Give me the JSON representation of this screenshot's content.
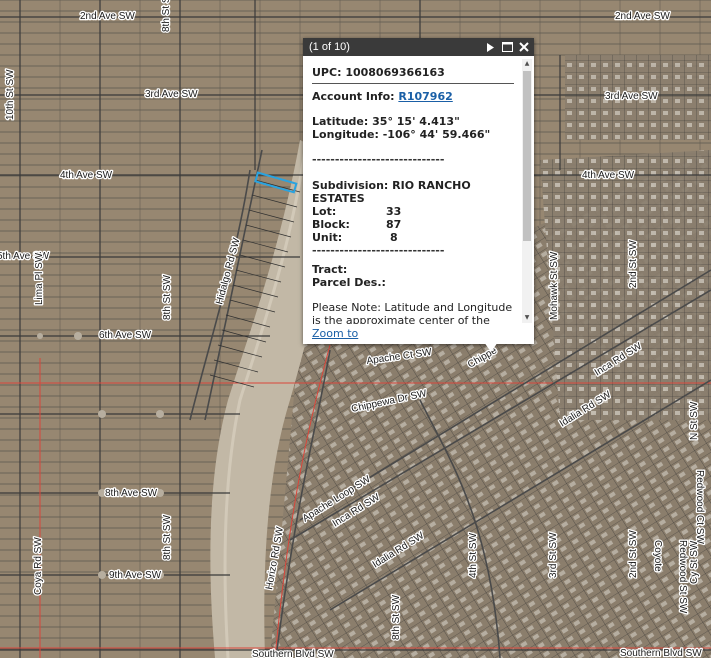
{
  "map": {
    "streets": {
      "2nd_ave_sw_w": "2nd Ave SW",
      "2nd_ave_sw_e": "2nd Ave SW",
      "3rd_ave_sw_w": "3rd Ave SW",
      "3rd_ave_sw_e": "3rd Ave SW",
      "4th_ave_sw_w": "4th Ave SW",
      "4th_ave_sw_e": "4th Ave SW",
      "5th_ave_sw": "5th Ave SW",
      "6th_ave_sw": "6th Ave SW",
      "8th_ave_sw": "8th Ave SW",
      "9th_ave_sw": "9th Ave SW",
      "10th_st_sw": "10th St SW",
      "8th_st_sw_n": "8th St SW",
      "8th_st_sw_mid": "8th St SW",
      "8th_st_sw_s": "8th St SW",
      "8th_st_sw_se": "8th St SW",
      "lima_pl_sw": "Lima Pl SW",
      "coya_rd_sw": "Coya Rd SW",
      "hidalgo_rd_sw": "Hidalgo Rd SW",
      "horizon_rd_sw": "Horizo Rd SW",
      "apache_ct_sw": "Apache Ct SW",
      "chippewa_dr_sw": "Chippewa Dr SW",
      "chippewa_short": "Chippe",
      "apache_loop_sw": "Apache Loop SW",
      "inca_rd_sw_e": "Inca Rd SW",
      "inca_rd_sw_w": "Inca Rd SW",
      "idalia_rd_sw_e": "Idalia Rd SW",
      "idalia_rd_sw_w": "Idalia Rd SW",
      "mohawk_st_sw": "Mohawk St SW",
      "2nd_st_sw_n": "2nd St SW",
      "2nd_st_sw_s": "2nd St SW",
      "3rd_st_sw": "3rd St SW",
      "4th_st_sw": "4th St SW",
      "1st_st_sw": "N St SW",
      "redwood_ct_sw": "Redwood Ct SW",
      "redwood_st_sw": "Redwood St SW",
      "cy_st_sw": "Cy St SW",
      "coyote": "Coyote",
      "southern_blvd_w": "Southern Blvd SW",
      "southern_blvd_e": "Southern Blvd SW"
    }
  },
  "popup": {
    "counter": "(1 of 10)",
    "upc_label": "UPC:",
    "upc_value": "1008069366163",
    "account_label": "Account Info:",
    "account_value": "R107962",
    "latitude_label": "Latitude:",
    "latitude_value": "35° 15' 4.413\"",
    "longitude_label": "Longitude:",
    "longitude_value": "-106° 44' 59.466\"",
    "divider": "-----------------------------",
    "subdivision_label": "Subdivision:",
    "subdivision_value": "RIO RANCHO ESTATES",
    "lot_label": "Lot:",
    "lot_value": "33",
    "block_label": "Block:",
    "block_value": "87",
    "unit_label": "Unit:",
    "unit_value": "8",
    "tract_label": "Tract:",
    "parcel_label": "Parcel Des.:",
    "note": "Please Note: Latitude and Longitude is the approximate center of the parcel shown.",
    "zoom_label": "Zoom to"
  },
  "colors": {
    "popup_header": "#3a3a3a",
    "link": "#1a5fa6",
    "parcel_highlight": "#29a3e0",
    "parcel_line": "#2f2f2f",
    "boundary_red": "#d9463b"
  }
}
